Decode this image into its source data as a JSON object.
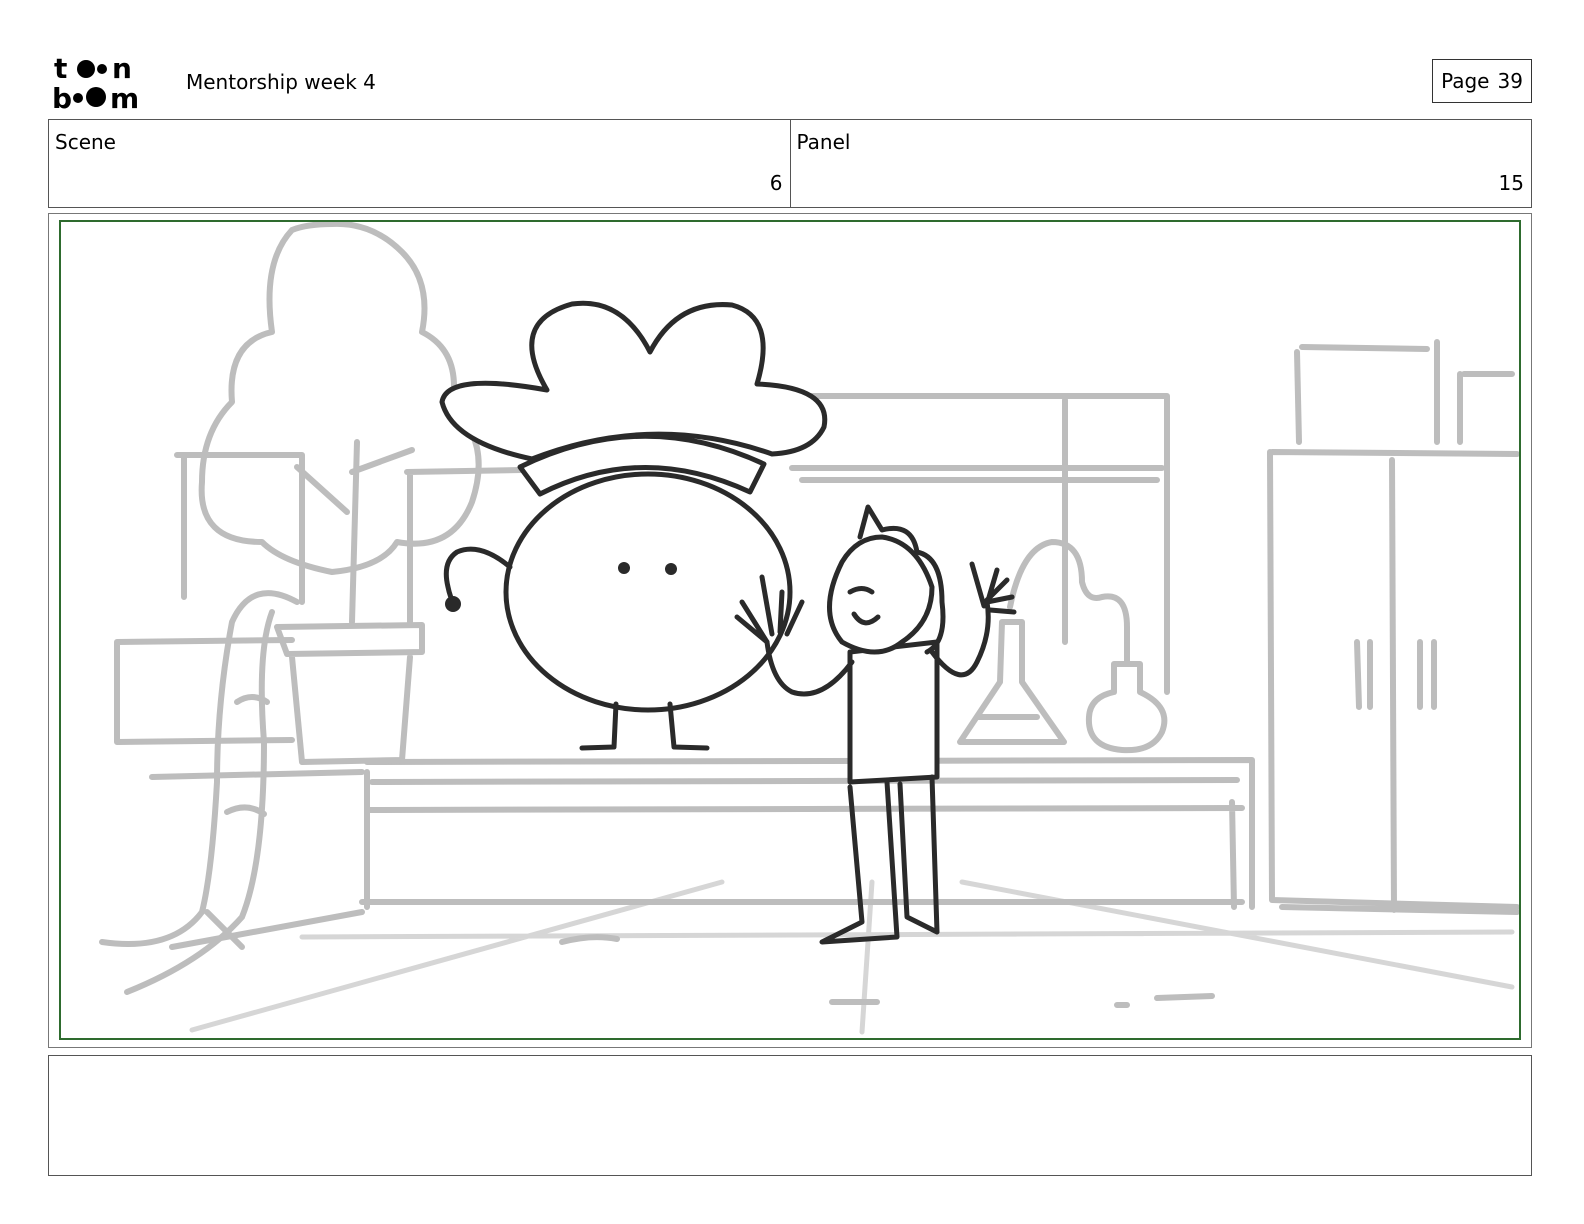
{
  "header": {
    "logo_text": "toon boom",
    "doc_title": "Mentorship week 4",
    "page_label": "Page",
    "page_number": "39"
  },
  "info": {
    "scene_label": "Scene",
    "scene_value": "6",
    "panel_label": "Panel",
    "panel_value": "15"
  },
  "notes": {
    "text": ""
  },
  "colors": {
    "safe_frame": "#2e6b2e",
    "sketch_background": "#bdbdbd",
    "sketch_ink": "#2a2a2a"
  }
}
